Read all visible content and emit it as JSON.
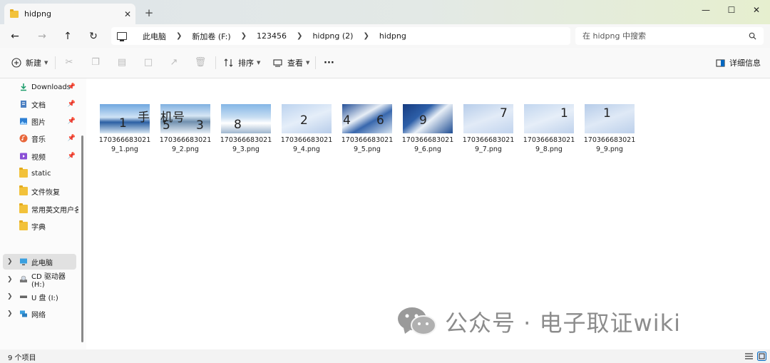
{
  "window": {
    "tab_title": "hidpng",
    "close_tab": "✕",
    "new_tab": "+",
    "minimize": "—",
    "maximize": "☐",
    "close": "✕"
  },
  "nav": {
    "back": "←",
    "forward": "→",
    "up": "↑",
    "refresh": "↻"
  },
  "breadcrumb": [
    "此电脑",
    "新加卷 (F:)",
    "123456",
    "hidpng (2)",
    "hidpng"
  ],
  "search": {
    "placeholder": "在 hidpng 中搜索"
  },
  "toolbar": {
    "new_label": "新建",
    "sort_label": "排序",
    "view_label": "查看",
    "more_label": "···",
    "details_label": "详细信息"
  },
  "sidebar": {
    "pinned": [
      {
        "label": "Downloads",
        "icon": "download-icon"
      },
      {
        "label": "文档",
        "icon": "document-icon"
      },
      {
        "label": "图片",
        "icon": "picture-icon"
      },
      {
        "label": "音乐",
        "icon": "music-icon"
      },
      {
        "label": "视频",
        "icon": "video-icon"
      }
    ],
    "folders": [
      "static",
      "文件恢复",
      "常用英文用户名",
      "字典"
    ],
    "drives": [
      {
        "label": "此电脑",
        "icon": "computer-icon"
      },
      {
        "label": "CD 驱动器 (H:)",
        "icon": "cd-drive-icon"
      },
      {
        "label": "U 盘 (I:)",
        "icon": "usb-drive-icon"
      },
      {
        "label": "网络",
        "icon": "network-icon"
      }
    ]
  },
  "files": [
    {
      "name": "1703666830219_1.png",
      "digits": [
        "1",
        "手"
      ]
    },
    {
      "name": "1703666830219_2.png",
      "digits": [
        "机号",
        "5",
        "3"
      ]
    },
    {
      "name": "1703666830219_3.png",
      "digits": [
        "8"
      ]
    },
    {
      "name": "1703666830219_4.png",
      "digits": [
        "2"
      ]
    },
    {
      "name": "1703666830219_5.png",
      "digits": [
        "4",
        "6"
      ]
    },
    {
      "name": "1703666830219_6.png",
      "digits": [
        "9"
      ]
    },
    {
      "name": "1703666830219_7.png",
      "digits": [
        "7"
      ]
    },
    {
      "name": "1703666830219_8.png",
      "digits": [
        "1"
      ]
    },
    {
      "name": "1703666830219_9.png",
      "digits": [
        "1"
      ]
    }
  ],
  "watermark": {
    "text": "公众号 · 电子取证wiki"
  },
  "status": {
    "item_count": "9 个项目"
  },
  "colors": {
    "accent": "#0067c0",
    "folder": "#f2c23b"
  }
}
